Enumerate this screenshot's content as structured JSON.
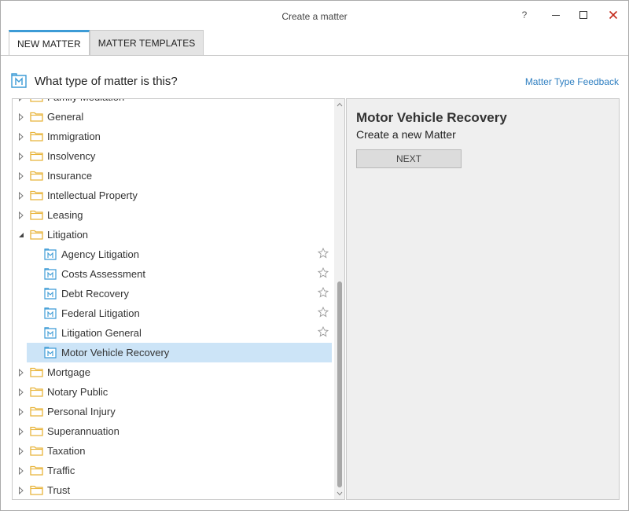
{
  "window": {
    "title": "Create a matter",
    "help_label": "?"
  },
  "tabs": [
    {
      "label": "NEW MATTER",
      "active": true
    },
    {
      "label": "MATTER TEMPLATES",
      "active": false
    }
  ],
  "header": {
    "question": "What type of matter is this?",
    "feedback_link": "Matter Type Feedback"
  },
  "tree": {
    "items": [
      {
        "label": "Family Mediation",
        "type": "folder",
        "expanded": false
      },
      {
        "label": "General",
        "type": "folder",
        "expanded": false
      },
      {
        "label": "Immigration",
        "type": "folder",
        "expanded": false
      },
      {
        "label": "Insolvency",
        "type": "folder",
        "expanded": false
      },
      {
        "label": "Insurance",
        "type": "folder",
        "expanded": false
      },
      {
        "label": "Intellectual Property",
        "type": "folder",
        "expanded": false
      },
      {
        "label": "Leasing",
        "type": "folder",
        "expanded": false
      },
      {
        "label": "Litigation",
        "type": "folder",
        "expanded": true
      },
      {
        "label": "Agency Litigation",
        "type": "matter",
        "starred": false
      },
      {
        "label": "Costs Assessment",
        "type": "matter",
        "starred": false
      },
      {
        "label": "Debt Recovery",
        "type": "matter",
        "starred": false
      },
      {
        "label": "Federal Litigation",
        "type": "matter",
        "starred": false
      },
      {
        "label": "Litigation General",
        "type": "matter",
        "starred": false
      },
      {
        "label": "Motor Vehicle Recovery",
        "type": "matter",
        "selected": true
      },
      {
        "label": "Mortgage",
        "type": "folder",
        "expanded": false
      },
      {
        "label": "Notary Public",
        "type": "folder",
        "expanded": false
      },
      {
        "label": "Personal Injury",
        "type": "folder",
        "expanded": false
      },
      {
        "label": "Superannuation",
        "type": "folder",
        "expanded": false
      },
      {
        "label": "Taxation",
        "type": "folder",
        "expanded": false
      },
      {
        "label": "Traffic",
        "type": "folder",
        "expanded": false
      },
      {
        "label": "Trust",
        "type": "folder",
        "expanded": false
      }
    ]
  },
  "detail": {
    "title": "Motor Vehicle Recovery",
    "subtitle": "Create a new Matter",
    "next_label": "NEXT"
  },
  "colors": {
    "accent": "#3c9bd6",
    "selection": "#cce4f7",
    "folder": "#e8b43a",
    "link": "#2f7fc1",
    "close": "#c42b1c"
  }
}
